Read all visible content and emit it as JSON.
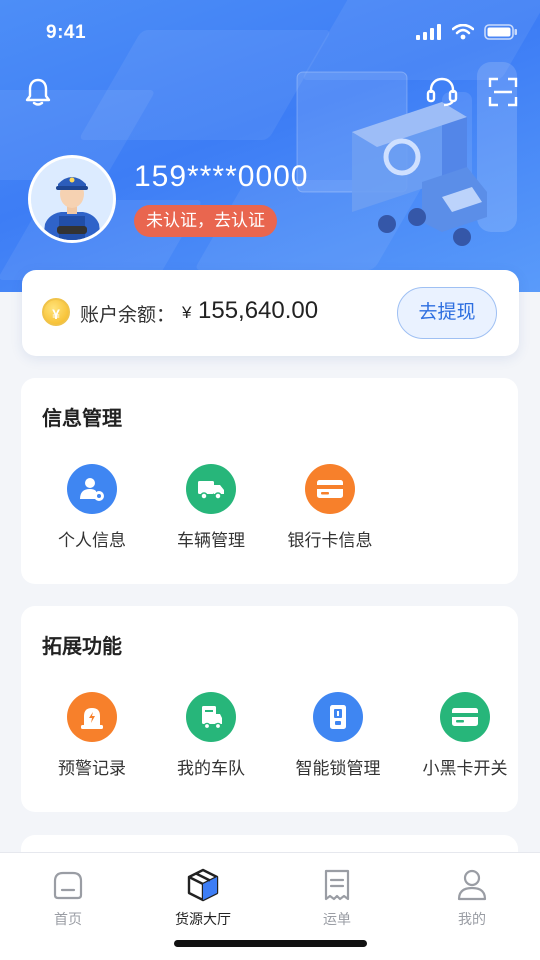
{
  "status_bar": {
    "time": "9:41"
  },
  "profile": {
    "phone": "159****0000",
    "verify_label": "未认证，去认证"
  },
  "balance": {
    "coin_symbol": "¥",
    "label": "账户余额：",
    "currency": "¥",
    "value": "155,640.00",
    "withdraw_label": "去提现"
  },
  "info_section": {
    "title": "信息管理",
    "items": [
      {
        "label": "个人信息",
        "icon": "user-settings-icon",
        "color": "#3f86f2"
      },
      {
        "label": "车辆管理",
        "icon": "truck-icon",
        "color": "#27b67a"
      },
      {
        "label": "银行卡信息",
        "icon": "bank-card-icon",
        "color": "#f7802b"
      }
    ]
  },
  "ext_section": {
    "title": "拓展功能",
    "items": [
      {
        "label": "预警记录",
        "icon": "alarm-light-icon",
        "color": "#f7802b"
      },
      {
        "label": "我的车队",
        "icon": "fleet-icon",
        "color": "#27b67a"
      },
      {
        "label": "智能锁管理",
        "icon": "smart-lock-icon",
        "color": "#3f86f2"
      },
      {
        "label": "小黑卡开关",
        "icon": "card-icon",
        "color": "#27b67a"
      }
    ]
  },
  "tabbar": {
    "tabs": [
      {
        "label": "首页",
        "icon": "home-icon",
        "active": false
      },
      {
        "label": "货源大厅",
        "icon": "cargo-box-icon",
        "active": true
      },
      {
        "label": "运单",
        "icon": "waybill-icon",
        "active": false
      },
      {
        "label": "我的",
        "icon": "user-icon",
        "active": false
      }
    ]
  },
  "colors": {
    "primary": "#3d7df5",
    "badge": "#e9664f",
    "accent_text": "#2e6fe0"
  }
}
